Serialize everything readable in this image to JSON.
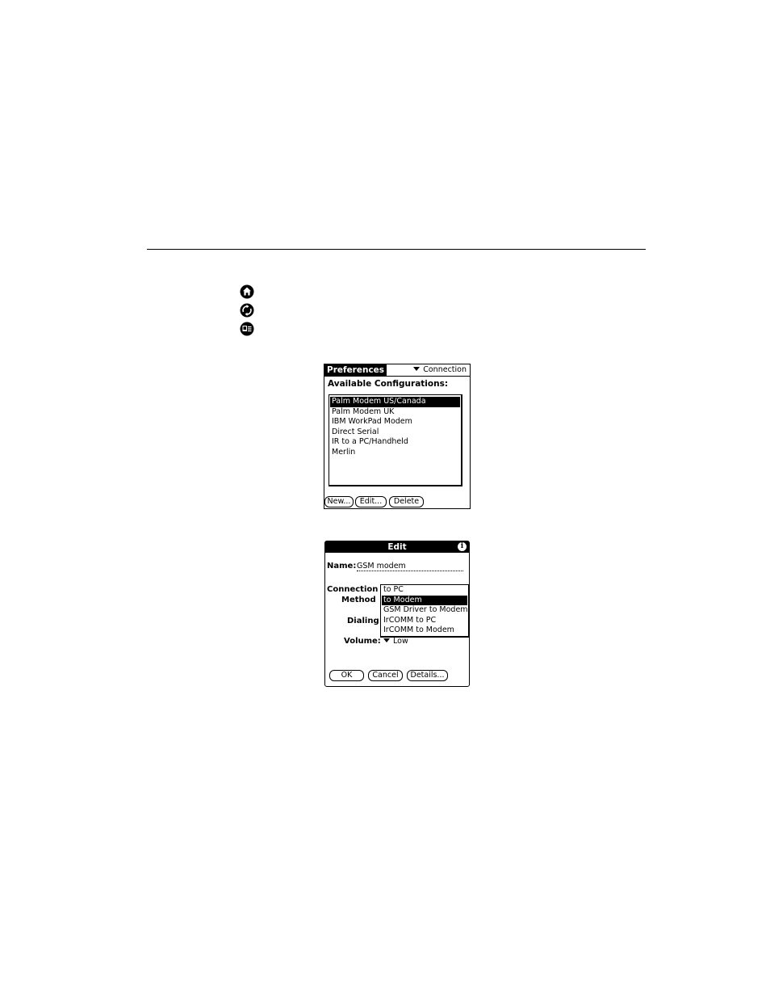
{
  "side_icons": [
    "home-icon",
    "sync-icon",
    "connect-icon"
  ],
  "preferences": {
    "title": "Preferences",
    "category_picker": "Connection",
    "list_label": "Available Configurations:",
    "configurations": [
      "Palm Modem US/Canada",
      "Palm Modem UK",
      "IBM WorkPad Modem",
      "Direct Serial",
      "IR to a PC/Handheld",
      "Merlin"
    ],
    "selected_index": 0,
    "buttons": {
      "new": "New...",
      "edit": "Edit...",
      "delete": "Delete"
    }
  },
  "edit_dialog": {
    "title": "Edit",
    "info_icon": "i",
    "name_label": "Name:",
    "name_value": "GSM modem",
    "connection_label": "Connection",
    "method_label": "Method",
    "dialing_label": "Dialing",
    "volume_label": "Volume:",
    "volume_value": "Low",
    "method_options": [
      "to PC",
      "to Modem",
      "GSM Driver to Modem",
      "IrCOMM to PC",
      "IrCOMM to Modem"
    ],
    "selected_option_index": 1,
    "buttons": {
      "ok": "OK",
      "cancel": "Cancel",
      "details": "Details..."
    }
  }
}
